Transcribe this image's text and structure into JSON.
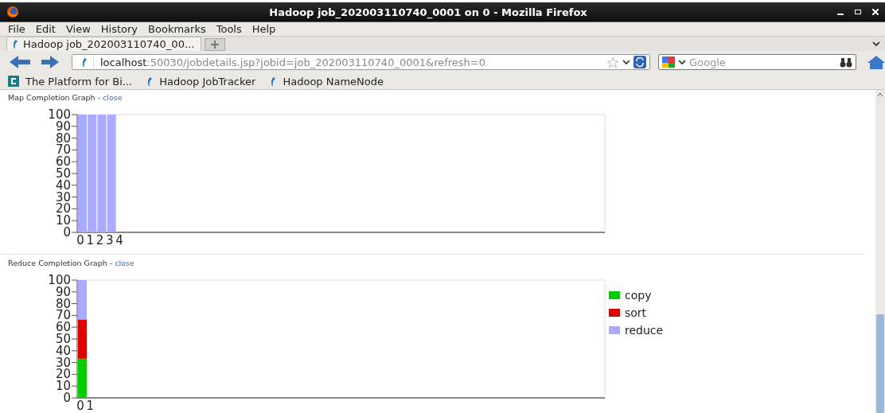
{
  "window": {
    "title": "Hadoop job_202003110740_0001 on 0 - Mozilla Firefox"
  },
  "menu": [
    "File",
    "Edit",
    "View",
    "History",
    "Bookmarks",
    "Tools",
    "Help"
  ],
  "tabs": [
    {
      "label": "Hadoop job_202003110740_00...",
      "selected": true
    }
  ],
  "address_bar": {
    "host": "localhost",
    "path": ":50030/jobdetails.jsp?jobid=job_202003110740_0001&refresh=0"
  },
  "search": {
    "placeholder": "Google"
  },
  "bookmarks": [
    {
      "label": "The Platform for Bi...",
      "kind": "square"
    },
    {
      "label": "Hadoop JobTracker",
      "kind": "feather"
    },
    {
      "label": "Hadoop NameNode",
      "kind": "feather"
    }
  ],
  "graphs": [
    {
      "title": "Map Completion Graph -",
      "link": "close",
      "chart_data": {
        "type": "bar",
        "categories": [
          "0",
          "1",
          "2",
          "3",
          "4"
        ],
        "series": [
          {
            "color": "#aaaaff",
            "values": [
              100,
              100,
              100,
              100,
              null
            ]
          }
        ],
        "ylim": [
          0,
          100
        ],
        "yticks": [
          0,
          10,
          20,
          30,
          40,
          50,
          60,
          70,
          80,
          90,
          100
        ],
        "stacked": true
      }
    },
    {
      "title": "Reduce Completion Graph -",
      "link": "close",
      "chart_data": {
        "type": "bar",
        "categories": [
          "0",
          "1"
        ],
        "series": [
          {
            "name": "copy",
            "color": "#00cc00",
            "values": [
              33.3,
              null
            ]
          },
          {
            "name": "sort",
            "color": "#dd0000",
            "values": [
              33.3,
              null
            ]
          },
          {
            "name": "reduce",
            "color": "#aaaaff",
            "values": [
              33.4,
              null
            ]
          }
        ],
        "ylim": [
          0,
          100
        ],
        "yticks": [
          0,
          10,
          20,
          30,
          40,
          50,
          60,
          70,
          80,
          90,
          100
        ],
        "stacked": true,
        "legend": true
      }
    }
  ]
}
